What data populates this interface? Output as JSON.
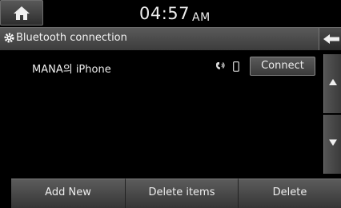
{
  "status": {
    "time": "04:57",
    "ampm": "AM"
  },
  "header": {
    "title": "Bluetooth connection"
  },
  "devices": [
    {
      "name": "MANA의 iPhone",
      "action_label": "Connect"
    }
  ],
  "footer": {
    "add_new": "Add New",
    "delete_items": "Delete items",
    "delete": "Delete"
  },
  "icons": {
    "home": "home-icon",
    "settings": "gear-icon",
    "back": "back-arrow-icon",
    "scroll_up": "triangle-up-icon",
    "scroll_down": "triangle-down-icon",
    "phone_link": "phone-audio-icon",
    "device": "phone-device-icon"
  }
}
